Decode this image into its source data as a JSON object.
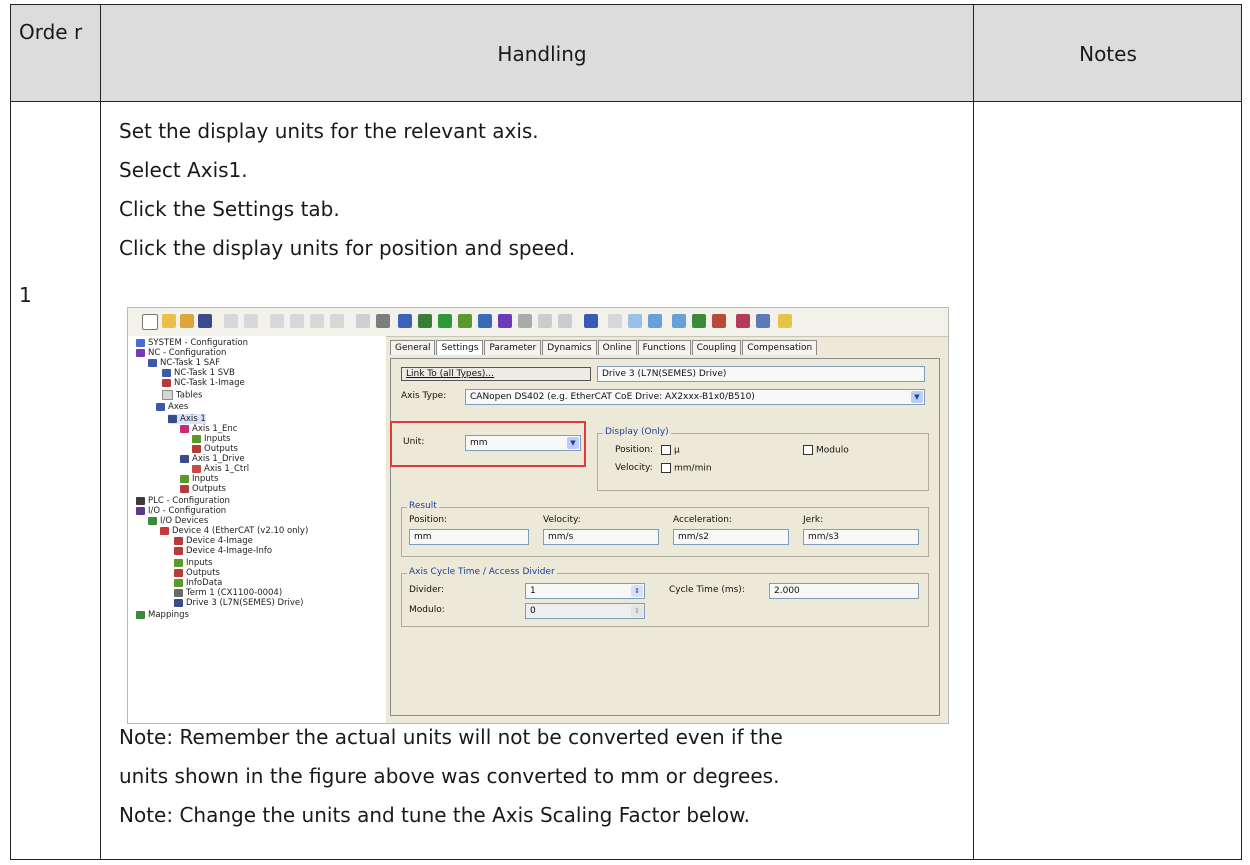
{
  "table": {
    "headers": {
      "order": "Orde r",
      "handling": "Handling",
      "notes": "Notes"
    },
    "row": {
      "order": "1",
      "steps": [
        "Set the display units for the relevant axis.",
        "Select Axis1.",
        "Click the Settings tab.",
        "Click the display units for position and speed."
      ],
      "notes_after": [
        "Note: Remember the actual units will not be converted even if the",
        "units shown in the figure above was converted to mm or degrees.",
        "Note: Change the units and tune the Axis Scaling Factor below."
      ],
      "notes_cell": ""
    }
  },
  "screenshot": {
    "tree": [
      "SYSTEM - Configuration",
      "NC - Configuration",
      "NC-Task 1 SAF",
      "NC-Task 1 SVB",
      "NC-Task 1-Image",
      "Tables",
      "Axes",
      "Axis 1",
      "Axis 1_Enc",
      "Inputs",
      "Outputs",
      "Axis 1_Drive",
      "Axis 1_Ctrl",
      "Inputs",
      "Outputs",
      "PLC - Configuration",
      "I/O - Configuration",
      "I/O Devices",
      "Device 4 (EtherCAT (v2.10 only)",
      "Device 4-Image",
      "Device 4-Image-Info",
      "Inputs",
      "Outputs",
      "InfoData",
      "Term 1 (CX1100-0004)",
      "Drive 3 (L7N(SEMES) Drive)",
      "Mappings"
    ],
    "tabs": [
      "General",
      "Settings",
      "Parameter",
      "Dynamics",
      "Online",
      "Functions",
      "Coupling",
      "Compensation"
    ],
    "link_button": "Link To (all Types)...",
    "link_value": "Drive 3 (L7N(SEMES) Drive)",
    "axis_type_label": "Axis Type:",
    "axis_type_value": "CANopen DS402  (e.g. EtherCAT CoE Drive: AX2xxx-B1x0/B510)",
    "unit_label": "Unit:",
    "unit_value": "mm",
    "display_title": "Display (Only)",
    "position_label": "Position:",
    "position_unit": "µ",
    "modulo_label": "Modulo",
    "velocity_label": "Velocity:",
    "velocity_unit": "mm/min",
    "result_title": "Result",
    "result": [
      {
        "label": "Position:",
        "value": "mm"
      },
      {
        "label": "Velocity:",
        "value": "mm/s"
      },
      {
        "label": "Acceleration:",
        "value": "mm/s2"
      },
      {
        "label": "Jerk:",
        "value": "mm/s3"
      }
    ],
    "cycle_title": "Axis Cycle Time / Access Divider",
    "divider_label": "Divider:",
    "divider_value": "1",
    "modulo2_label": "Modulo:",
    "modulo2_value": "0",
    "cycle_label": "Cycle Time (ms):",
    "cycle_value": "2.000"
  }
}
